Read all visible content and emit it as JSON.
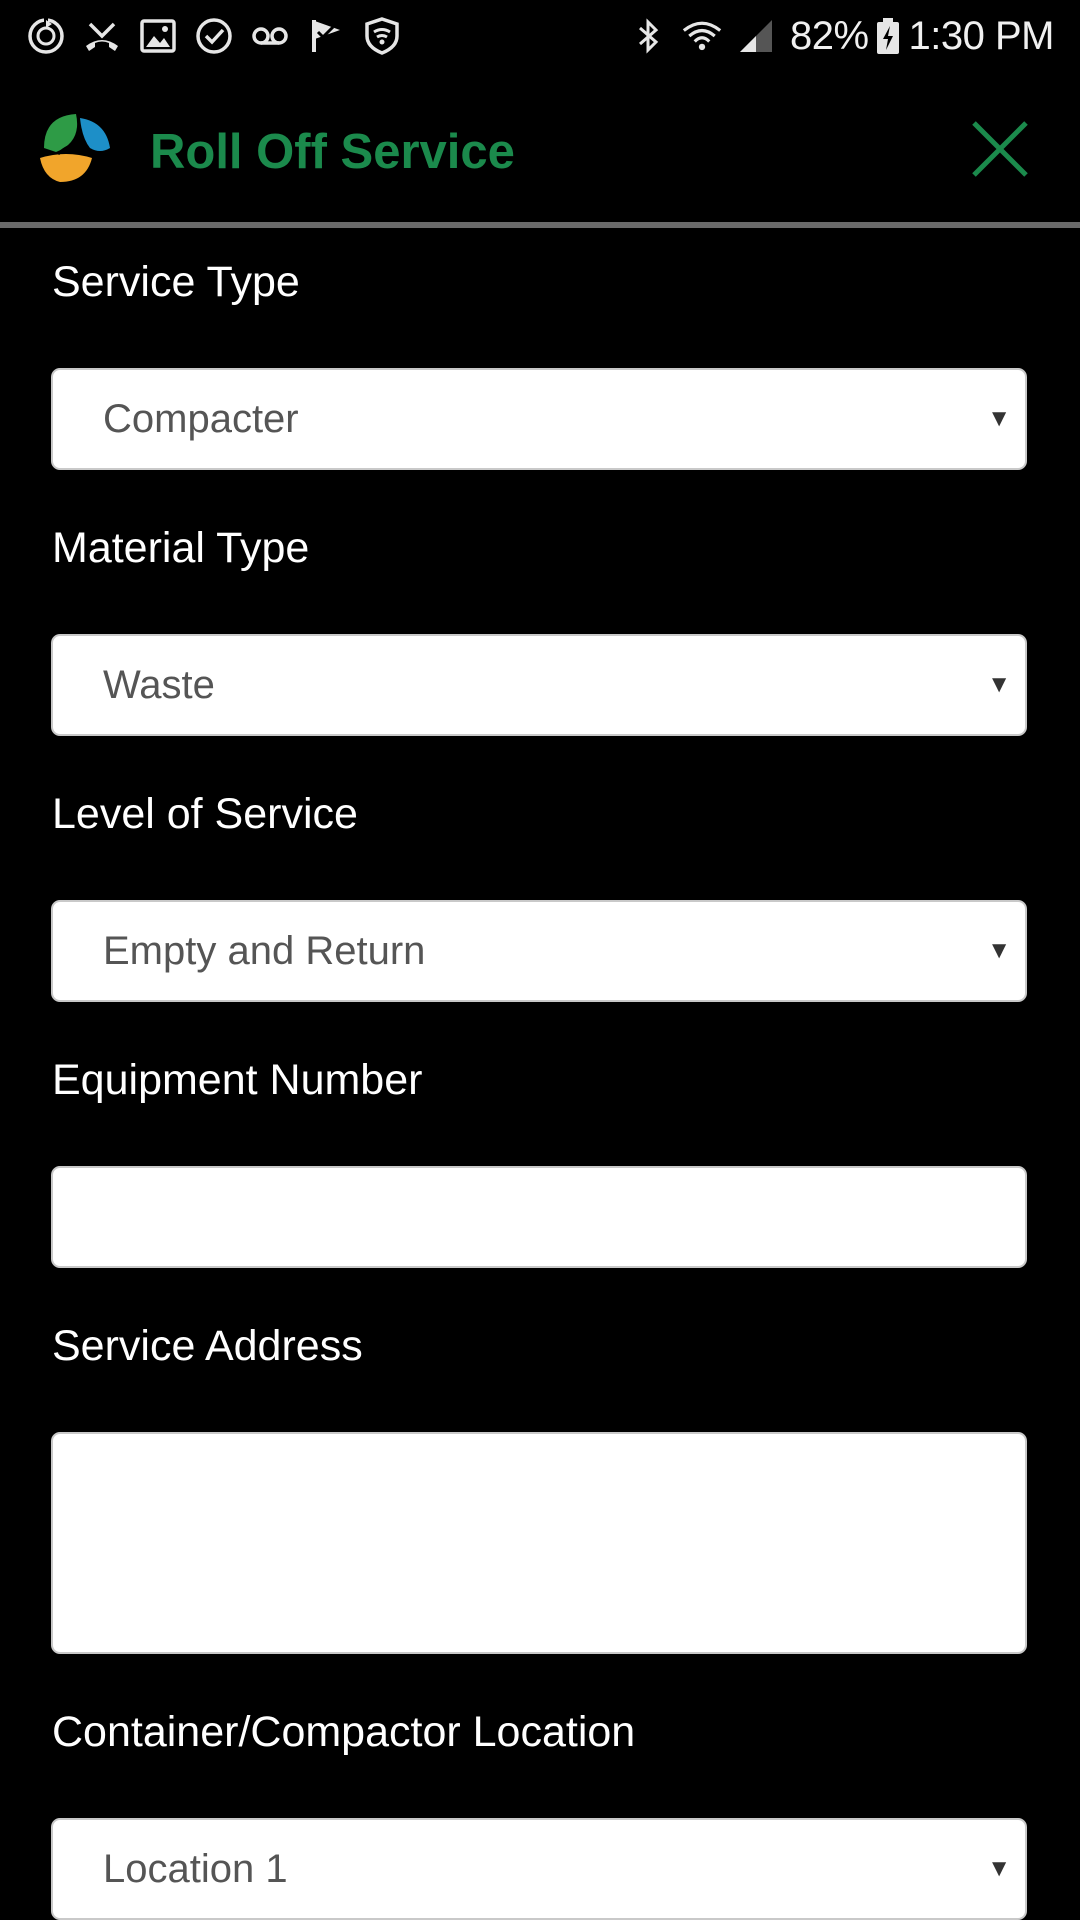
{
  "status_bar": {
    "left_icons": [
      "sync-icon",
      "missed-call-icon",
      "image-icon",
      "check-circle-icon",
      "voicemail-icon",
      "task-flag-icon",
      "shield-icon"
    ],
    "right_icons": [
      "bluetooth-icon",
      "wifi-icon",
      "signal-icon",
      "battery-icon"
    ],
    "battery_percent": "82%",
    "time": "1:30 PM"
  },
  "app_bar": {
    "title": "Roll Off Service",
    "title_color": "#1b8a4c",
    "close_icon": "close-icon"
  },
  "form": {
    "service_type": {
      "label": "Service Type",
      "value": "Compacter"
    },
    "material_type": {
      "label": "Material Type",
      "value": "Waste"
    },
    "level_of_service": {
      "label": "Level of Service",
      "value": "Empty and Return"
    },
    "equipment_number": {
      "label": "Equipment Number",
      "value": ""
    },
    "service_address": {
      "label": "Service Address",
      "value": ""
    },
    "container_location": {
      "label": "Container/Compactor Location",
      "value": "Location 1"
    },
    "caret": "▼"
  }
}
